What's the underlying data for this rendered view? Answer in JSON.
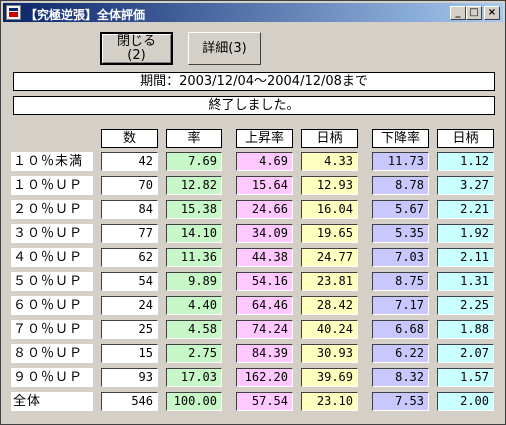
{
  "window": {
    "title": "【究極逆張】全体評価",
    "minimize": "_",
    "maximize": "□",
    "close": "×"
  },
  "buttons": {
    "close_label": "閉じる",
    "close_hotkey": "(2)",
    "detail_label": "詳細(3)"
  },
  "period_text": "期間：2003/12/04～2004/12/08まで",
  "status_text": "終了しました。",
  "colors": {
    "rate": "#c8f7c8",
    "rise_rate": "#ffc8ff",
    "rise_days": "#ffffc0",
    "fall_rate": "#c8c8ff",
    "fall_days": "#c8ffff",
    "count": "#ffffff"
  },
  "table": {
    "headers": [
      "数",
      "率",
      "上昇率",
      "日柄",
      "下降率",
      "日柄"
    ],
    "rows": [
      {
        "label": "１０％未満",
        "count": "42",
        "rate": "7.69",
        "rise_rate": "4.69",
        "rise_days": "4.33",
        "fall_rate": "11.73",
        "fall_days": "1.12"
      },
      {
        "label": "１０％ＵＰ",
        "count": "70",
        "rate": "12.82",
        "rise_rate": "15.64",
        "rise_days": "12.93",
        "fall_rate": "8.78",
        "fall_days": "3.27"
      },
      {
        "label": "２０％ＵＰ",
        "count": "84",
        "rate": "15.38",
        "rise_rate": "24.66",
        "rise_days": "16.04",
        "fall_rate": "5.67",
        "fall_days": "2.21"
      },
      {
        "label": "３０％ＵＰ",
        "count": "77",
        "rate": "14.10",
        "rise_rate": "34.09",
        "rise_days": "19.65",
        "fall_rate": "5.35",
        "fall_days": "1.92"
      },
      {
        "label": "４０％ＵＰ",
        "count": "62",
        "rate": "11.36",
        "rise_rate": "44.38",
        "rise_days": "24.77",
        "fall_rate": "7.03",
        "fall_days": "2.11"
      },
      {
        "label": "５０％ＵＰ",
        "count": "54",
        "rate": "9.89",
        "rise_rate": "54.16",
        "rise_days": "23.81",
        "fall_rate": "8.75",
        "fall_days": "1.31"
      },
      {
        "label": "６０％ＵＰ",
        "count": "24",
        "rate": "4.40",
        "rise_rate": "64.46",
        "rise_days": "28.42",
        "fall_rate": "7.17",
        "fall_days": "2.25"
      },
      {
        "label": "７０％ＵＰ",
        "count": "25",
        "rate": "4.58",
        "rise_rate": "74.24",
        "rise_days": "40.24",
        "fall_rate": "6.68",
        "fall_days": "1.88"
      },
      {
        "label": "８０％ＵＰ",
        "count": "15",
        "rate": "2.75",
        "rise_rate": "84.39",
        "rise_days": "30.93",
        "fall_rate": "6.22",
        "fall_days": "2.07"
      },
      {
        "label": "９０％ＵＰ",
        "count": "93",
        "rate": "17.03",
        "rise_rate": "162.20",
        "rise_days": "39.69",
        "fall_rate": "8.32",
        "fall_days": "1.57"
      },
      {
        "label": "全体",
        "count": "546",
        "rate": "100.00",
        "rise_rate": "57.54",
        "rise_days": "23.10",
        "fall_rate": "7.53",
        "fall_days": "2.00"
      }
    ]
  }
}
